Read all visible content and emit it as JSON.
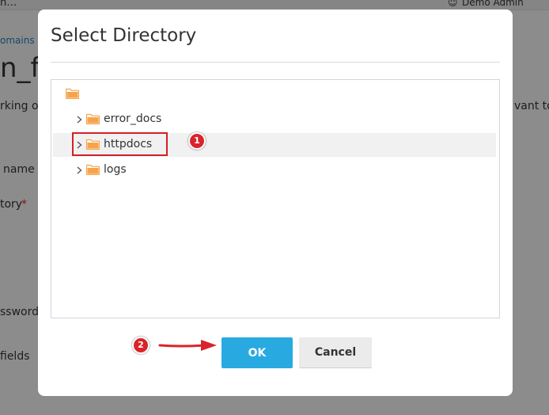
{
  "background": {
    "breadcrumb_fragment": "n…",
    "domains_fragment": "omains",
    "user": "Demo Admin",
    "title_fragment": "n_ft",
    "desc_fragment_left": "rking o",
    "desc_fragment_right": "vant to",
    "label_name": "name",
    "label_directory": "tory",
    "required_mark": "*",
    "label_password": "ssword",
    "label_fields": "fields"
  },
  "dialog": {
    "title": "Select Directory",
    "tree": {
      "items": [
        {
          "label": "error_docs"
        },
        {
          "label": "httpdocs"
        },
        {
          "label": "logs"
        }
      ]
    },
    "ok_label": "OK",
    "cancel_label": "Cancel"
  },
  "annotations": {
    "step1": "1",
    "step2": "2",
    "accent_color": "#d9242b"
  },
  "colors": {
    "ok_button": "#28aae1",
    "folder": "#f6a44b"
  }
}
